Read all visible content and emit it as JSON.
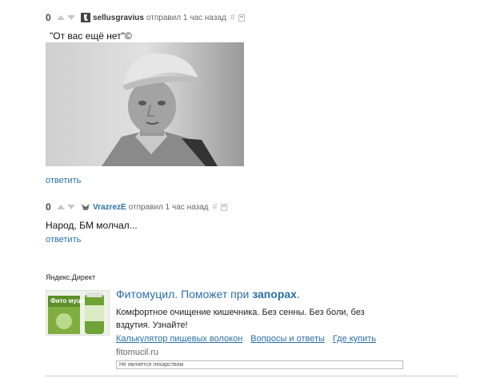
{
  "comments": [
    {
      "score": "0",
      "author": "sellusgravius",
      "meta": "отправил 1 час назад",
      "hash": "#",
      "text": "\"От вас ещё нет\"©",
      "reply": "ответить",
      "author_color": "#333333"
    },
    {
      "score": "0",
      "author": "VrazrezE",
      "meta": "отправил 1 час назад",
      "hash": "#",
      "text": "Народ, БМ молчал...",
      "reply": "ответить",
      "author_color": "#2a6fa8"
    }
  ],
  "ad": {
    "label": "Яндекс.Директ",
    "title_main": "Фитомуцил. Поможет при ",
    "title_bold": "запорах",
    "title_end": ".",
    "body": "Комфортное очищение кишечника. Без сенны. Без боли, без вздутия. Узнайте!",
    "links": [
      "Калькулятор пищевых волокон",
      "Вопросы и ответы",
      "Где купить"
    ],
    "domain": "fitomucil.ru",
    "warning": "Не является лекарством",
    "thumb_brand": "Фито муцил"
  },
  "colors": {
    "link": "#2a6fa8",
    "vote": "#c8c8c8"
  }
}
